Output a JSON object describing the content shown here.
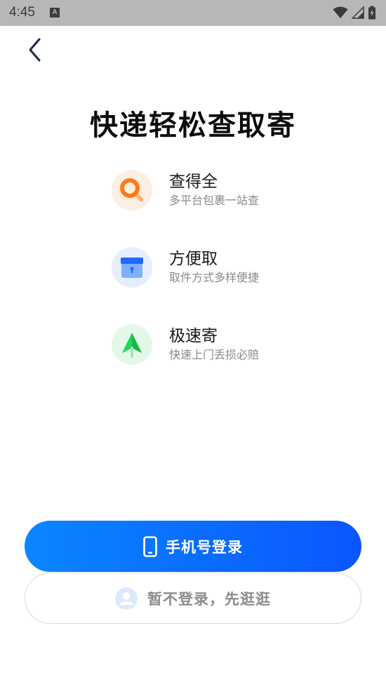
{
  "status_bar": {
    "time": "4:45",
    "notification_icon": "A"
  },
  "header": {
    "back_icon": "chevron-left-icon"
  },
  "title": "快递轻松查取寄",
  "features": [
    {
      "icon": "search-icon",
      "title": "查得全",
      "desc": "多平台包裹一站查",
      "accent": "#ff7a1a"
    },
    {
      "icon": "box-icon",
      "title": "方便取",
      "desc": "取件方式多样便捷",
      "accent": "#2f7bff"
    },
    {
      "icon": "arrow-up-icon",
      "title": "极速寄",
      "desc": "快速上门丢损必赔",
      "accent": "#22c55e"
    }
  ],
  "actions": {
    "phone_login_label": "手机号登录",
    "guest_label": "暂不登录，先逛逛"
  },
  "colors": {
    "primary_start": "#0a86ff",
    "primary_end": "#0b56ff",
    "status_bar_bg": "#b7b7b7"
  }
}
